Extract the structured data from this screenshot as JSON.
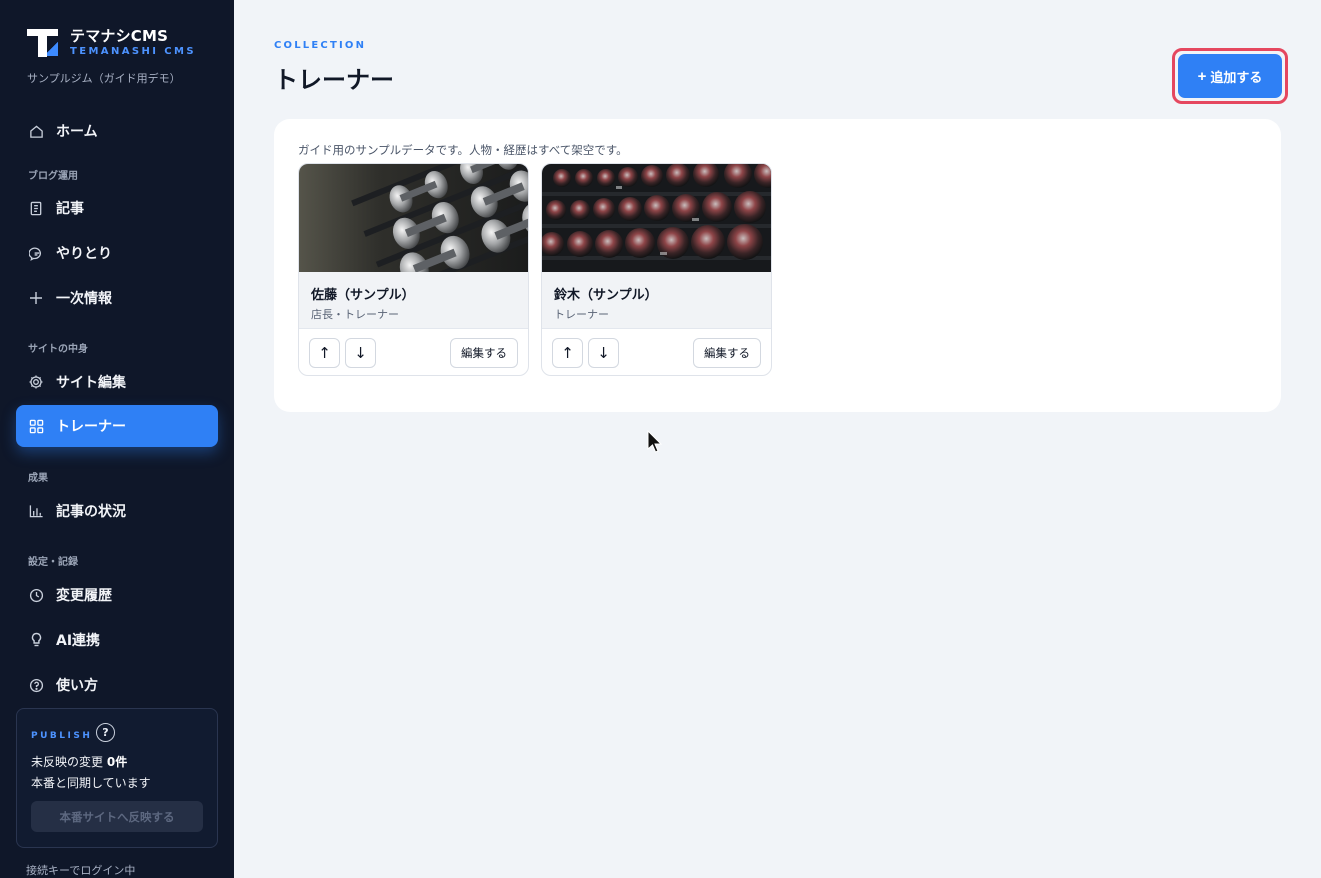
{
  "brand": {
    "name": "テマナシCMS",
    "subtitle": "TEMANASHI CMS",
    "site_name": "サンプルジム（ガイド用デモ）"
  },
  "sidebar": {
    "home": "ホーム",
    "sections": {
      "blog": "ブログ運用",
      "site": "サイトの中身",
      "results": "成果",
      "settings": "設定・記録"
    },
    "items": {
      "articles": "記事",
      "exchanges": "やりとり",
      "primary_info": "一次情報",
      "site_edit": "サイト編集",
      "trainers": "トレーナー",
      "article_status": "記事の状況",
      "history": "変更履歴",
      "ai": "AI連携",
      "usage": "使い方"
    },
    "active": "trainers",
    "publish": {
      "label": "PUBLISH",
      "help": "?",
      "changes_prefix": "未反映の変更",
      "changes_count": "0件",
      "sync_status": "本番と同期しています",
      "button": "本番サイトへ反映する"
    },
    "login_status": "接続キーでログイン中"
  },
  "header": {
    "kicker": "COLLECTION",
    "title": "トレーナー",
    "add_button": "追加する",
    "add_icon": "plus-icon"
  },
  "panel": {
    "note": "ガイド用のサンプルデータです。人物・経歴はすべて架空です。",
    "cards": [
      {
        "name": "佐藤（サンプル）",
        "role": "店長・トレーナー",
        "edit": "編集する",
        "up": "↑",
        "down": "↓"
      },
      {
        "name": "鈴木（サンプル）",
        "role": "トレーナー",
        "edit": "編集する",
        "up": "↑",
        "down": "↓"
      }
    ]
  },
  "colors": {
    "sidebar_bg": "#0f1729",
    "accent": "#2f80f5",
    "focus_ring": "#e5475f",
    "page_bg": "#f1f4f8"
  }
}
